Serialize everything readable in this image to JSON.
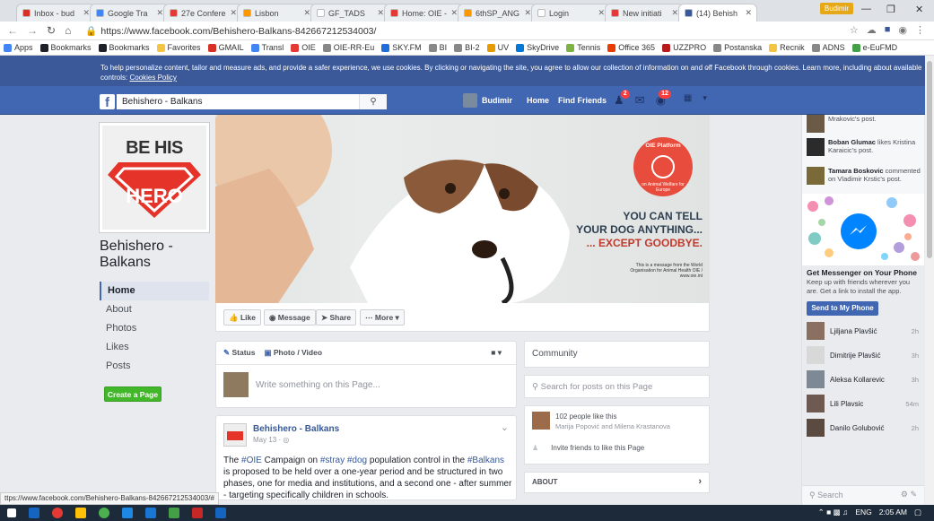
{
  "browser": {
    "tabs": [
      {
        "title": "Inbox - bud",
        "color": "#d93025"
      },
      {
        "title": "Google Tra",
        "color": "#4285f4"
      },
      {
        "title": "27e Confere",
        "color": "#e53935"
      },
      {
        "title": "Lisbon",
        "color": "#ff9800"
      },
      {
        "title": "GF_TADS",
        "color": "#ffffff"
      },
      {
        "title": "Home: OIE -",
        "color": "#e53935"
      },
      {
        "title": "6thSP_ANG",
        "color": "#ff9800"
      },
      {
        "title": "Login",
        "color": "#ffffff"
      },
      {
        "title": "New initiati",
        "color": "#e53935"
      },
      {
        "title": "(14) Behish",
        "color": "#3b5998",
        "active": true
      }
    ],
    "user_badge": "Budimir",
    "url": "https://www.facebook.com/Behishero-Balkans-842667212534003/",
    "bookmarks": [
      {
        "label": "Apps",
        "color": "#4285f4"
      },
      {
        "label": "Bookmarks",
        "color": "#1d2129"
      },
      {
        "label": "Bookmarks",
        "color": "#1d2129"
      },
      {
        "label": "Favorites",
        "color": "#f4c542"
      },
      {
        "label": "GMAIL",
        "color": "#d93025"
      },
      {
        "label": "Transl",
        "color": "#4285f4"
      },
      {
        "label": "OIE",
        "color": "#e53935"
      },
      {
        "label": "OIE-RR-Eu",
        "color": "#888888"
      },
      {
        "label": "SKY.FM",
        "color": "#1e6fd9"
      },
      {
        "label": "BI",
        "color": "#888888"
      },
      {
        "label": "BI-2",
        "color": "#888888"
      },
      {
        "label": "UV",
        "color": "#e69b00"
      },
      {
        "label": "SkyDrive",
        "color": "#0078d7"
      },
      {
        "label": "Tennis",
        "color": "#7cb342"
      },
      {
        "label": "Office 365",
        "color": "#eb3c00"
      },
      {
        "label": "UZZPRO",
        "color": "#b71c1c"
      },
      {
        "label": "Postanska",
        "color": "#888888"
      },
      {
        "label": "Recnik",
        "color": "#f4c542"
      },
      {
        "label": "ADNS",
        "color": "#888888"
      },
      {
        "label": "e-EuFMD",
        "color": "#43a047"
      }
    ],
    "status_url": "ttps://www.facebook.com/Behishero-Balkans-842667212534003/#"
  },
  "cookie": {
    "text": "To help personalize content, tailor and measure ads, and provide a safer experience, we use cookies. By clicking or navigating the site, you agree to allow our collection of information on and off Facebook through cookies. Learn more, including about available controls:",
    "link": "Cookies Policy"
  },
  "fb": {
    "search_value": "Behishero - Balkans",
    "user_name": "Budimir",
    "nav_home": "Home",
    "nav_find_friends": "Find Friends",
    "badge_friends": "2",
    "badge_notifications": "12"
  },
  "page": {
    "logo_text_top": "BE HIS",
    "logo_text_hero": "HERO",
    "name": "Behishero - Balkans",
    "nav": [
      "Home",
      "About",
      "Photos",
      "Likes",
      "Posts"
    ],
    "create_page": "Create a Page"
  },
  "cover": {
    "line1": "YOU CAN TELL",
    "line2": "YOUR DOG ANYTHING...",
    "line3": "... EXCEPT GOODBYE.",
    "small": "This is a message from the World Organisation for Animal Health OIE / www.oie.int",
    "badge": "OIE Platform",
    "badge_sub": "on Animal Welfare for Europe"
  },
  "actions": {
    "like": "Like",
    "message": "Message",
    "share": "Share",
    "more": "More"
  },
  "composer": {
    "status": "Status",
    "photo": "Photo / Video",
    "placeholder": "Write something on this Page..."
  },
  "post": {
    "author": "Behishero - Balkans",
    "date": "May 13 ·",
    "text_parts": [
      "The ",
      "#OIE",
      " Campaign on ",
      "#stray",
      " ",
      "#dog",
      " population control in the ",
      "#Balkans",
      " is proposed to be held over a one-year period and be structured in two phases, one for media and institutions, and a second one - after summer - targeting specifically children in schools."
    ]
  },
  "sidebar": {
    "community": "Community",
    "search_posts": "Search for posts on this Page",
    "likes_count": "102 people like this",
    "likes_names": "Marija Popović and Milena Krastanova",
    "invite": "Invite friends to like this Page",
    "about": "ABOUT"
  },
  "ticker": [
    {
      "text": "Mrakovic's post.",
      "color": "#6b5a45"
    },
    {
      "name": "Boban Glumac",
      "action": " likes Kristina Karaicic's post.",
      "color": "#2b2b2b"
    },
    {
      "name": "Tamara Boskovic",
      "action": " commented on Vladimir Krstic's post.",
      "color": "#7a6a3a"
    }
  ],
  "messenger_ad": {
    "title": "Get Messenger on Your Phone",
    "desc": "Keep up with friends wherever you are. Get a link to install the app.",
    "button": "Send to My Phone"
  },
  "chat": [
    {
      "name": "Ljiljana Plavšić",
      "time": "2h",
      "color": "#8a7060"
    },
    {
      "name": "Dimitrije Plavšić",
      "time": "3h",
      "color": "#d8d8d8"
    },
    {
      "name": "Aleksa Kollarevic",
      "time": "3h",
      "color": "#7d8a96"
    },
    {
      "name": "Lili Plavsic",
      "time": "54m",
      "color": "#6e5a50"
    },
    {
      "name": "Danilo Golubović",
      "time": "2h",
      "color": "#5a4a40"
    }
  ],
  "chat_search": "Search",
  "taskbar": {
    "time": "2:05 AM",
    "lang": "ENG"
  },
  "colors": {
    "fb_blue": "#4267b2",
    "cookie_blue": "#3b5998",
    "green": "#42b72a",
    "link": "#365899"
  }
}
